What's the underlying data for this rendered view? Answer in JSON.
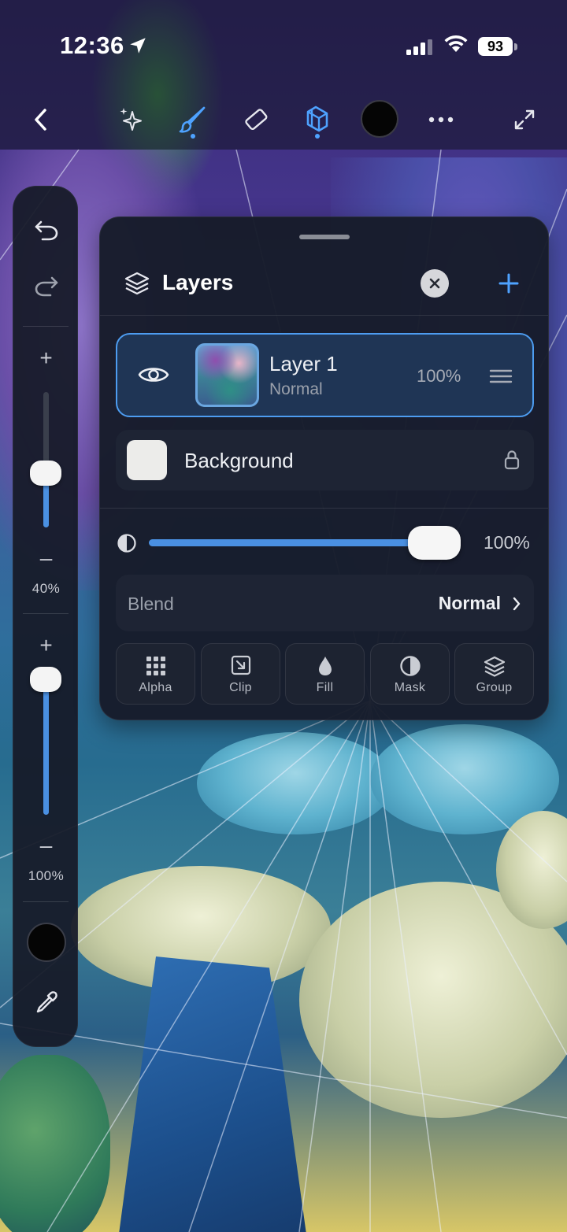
{
  "status_bar": {
    "time": "12:36",
    "battery": "93"
  },
  "toolbar": {
    "items": [
      {
        "icon": "back-chevron-icon"
      },
      {
        "icon": "sparkles-icon"
      },
      {
        "icon": "brush-icon",
        "selected": true
      },
      {
        "icon": "eraser-icon"
      },
      {
        "icon": "layers-icon",
        "selected": true
      },
      {
        "icon": "color-swatch"
      },
      {
        "icon": "more-icon"
      },
      {
        "icon": "expand-icon"
      }
    ],
    "current_color": "#050505",
    "accent_color": "#4ea2ff"
  },
  "left_rail": {
    "size_slider": {
      "value_label": "40%",
      "level": 0.4
    },
    "opacity_slider": {
      "value_label": "100%",
      "level": 1.0
    },
    "plus": "+",
    "minus": "–",
    "current_color": "#050505"
  },
  "layers_panel": {
    "title": "Layers",
    "layers": [
      {
        "name": "Layer 1",
        "blend": "Normal",
        "opacity": "100%",
        "selected": true,
        "visible": true
      },
      {
        "name": "Background",
        "locked": true,
        "swatch_color": "#ececea"
      }
    ],
    "opacity": {
      "value_label": "100%",
      "level": 1.0
    },
    "blend": {
      "label": "Blend",
      "value": "Normal"
    },
    "actions": [
      {
        "label": "Alpha",
        "icon": "grid-dots-icon"
      },
      {
        "label": "Clip",
        "icon": "clip-arrow-icon"
      },
      {
        "label": "Fill",
        "icon": "drop-icon"
      },
      {
        "label": "Mask",
        "icon": "half-circle-icon"
      },
      {
        "label": "Group",
        "icon": "stack-icon"
      }
    ]
  }
}
